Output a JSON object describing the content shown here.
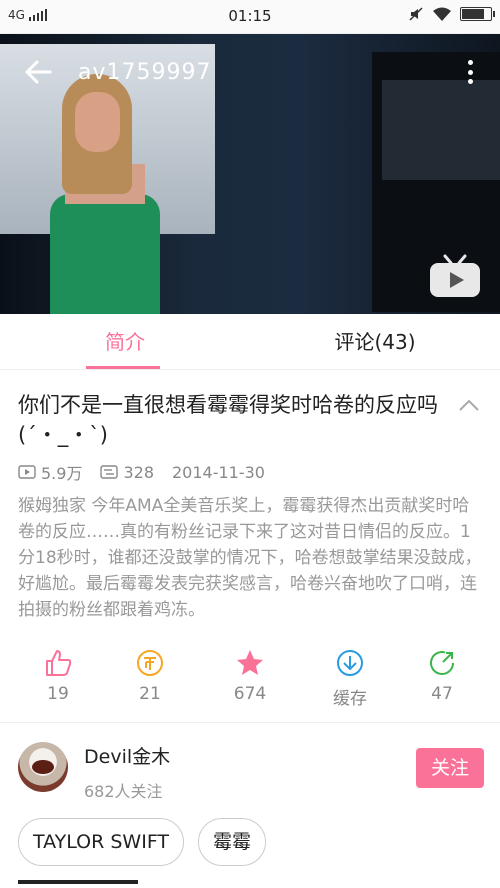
{
  "status_bar": {
    "network": "4G",
    "time": "01:15"
  },
  "video": {
    "title": "av1759997"
  },
  "tabs": [
    {
      "label": "简介"
    },
    {
      "label": "评论(43)"
    }
  ],
  "content": {
    "title": "你们不是一直很想看霉霉得奖时哈卷的反应吗(´・_・`)",
    "plays": "5.9万",
    "danmaku": "328",
    "date": "2014-11-30",
    "description": "猴姆独家 今年AMA全美音乐奖上，霉霉获得杰出贡献奖时哈卷的反应……真的有粉丝记录下来了这对昔日情侣的反应。1分18秒时，谁都还没鼓掌的情况下，哈卷想鼓掌结果没鼓成，好尴尬。最后霉霉发表完获奖感言，哈卷兴奋地吹了口哨，连拍摄的粉丝都跟着鸡冻。"
  },
  "actions": [
    {
      "icon": "thumbs-up-icon",
      "count": "19"
    },
    {
      "icon": "coin-icon",
      "count": "21"
    },
    {
      "icon": "star-icon",
      "count": "674"
    },
    {
      "icon": "download-icon",
      "count": "缓存"
    },
    {
      "icon": "share-icon",
      "count": "47"
    }
  ],
  "uploader": {
    "name": "Devil金木",
    "followers": "682人关注",
    "follow_label": "关注"
  },
  "tags": [
    "TAYLOR SWIFT",
    "霉霉"
  ],
  "colors": {
    "accent": "#fb7299",
    "coin": "#f5a623",
    "download": "#2a9be0",
    "share": "#3bb54a"
  }
}
